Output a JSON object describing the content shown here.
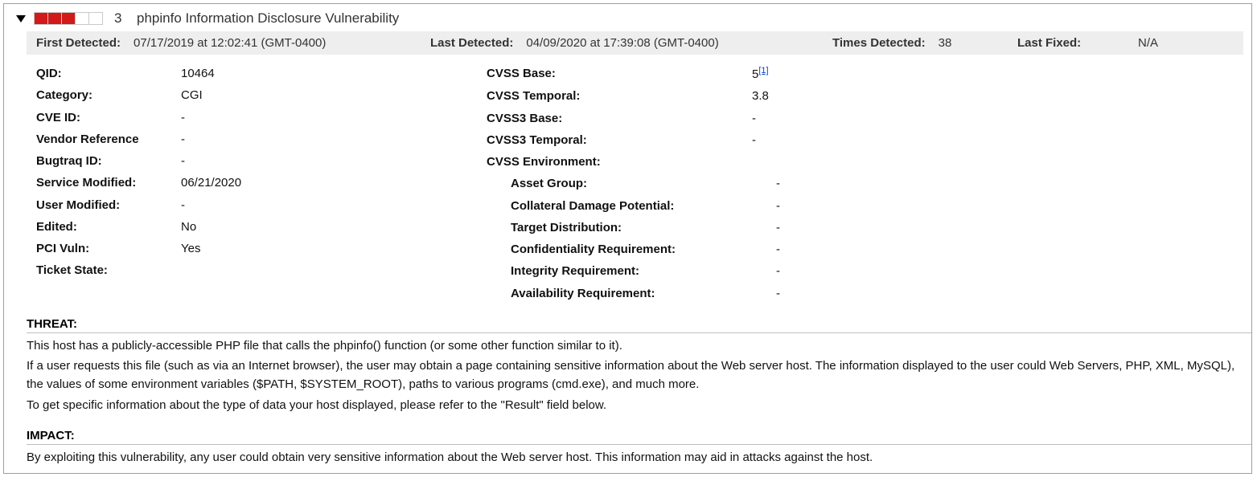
{
  "header": {
    "severity_level": 3,
    "title": "phpinfo Information Disclosure Vulnerability"
  },
  "detection": {
    "first_detected_label": "First Detected:",
    "first_detected_value": "07/17/2019 at 12:02:41 (GMT-0400)",
    "last_detected_label": "Last Detected:",
    "last_detected_value": "04/09/2020 at 17:39:08 (GMT-0400)",
    "times_detected_label": "Times Detected:",
    "times_detected_value": "38",
    "last_fixed_label": "Last Fixed:",
    "last_fixed_value": "N/A"
  },
  "details": {
    "left": {
      "qid": {
        "k": "QID:",
        "v": "10464"
      },
      "category": {
        "k": "Category:",
        "v": "CGI"
      },
      "cve_id": {
        "k": "CVE ID:",
        "v": "-"
      },
      "vendor_ref": {
        "k": "Vendor Reference",
        "v": "-"
      },
      "bugtraq_id": {
        "k": "Bugtraq ID:",
        "v": "-"
      },
      "service_modified": {
        "k": "Service Modified:",
        "v": "06/21/2020"
      },
      "user_modified": {
        "k": "User Modified:",
        "v": "-"
      },
      "edited": {
        "k": "Edited:",
        "v": "No"
      },
      "pci_vuln": {
        "k": "PCI Vuln:",
        "v": "Yes"
      },
      "ticket_state": {
        "k": "Ticket State:",
        "v": ""
      }
    },
    "right": {
      "cvss_base": {
        "k": "CVSS Base:",
        "v": "5",
        "note": "[1]"
      },
      "cvss_temporal": {
        "k": "CVSS Temporal:",
        "v": "3.8"
      },
      "cvss3_base": {
        "k": "CVSS3 Base:",
        "v": "-"
      },
      "cvss3_temporal": {
        "k": "CVSS3 Temporal:",
        "v": "-"
      },
      "cvss_env": {
        "k": "CVSS Environment:",
        "v": ""
      },
      "asset_group": {
        "k": "Asset Group:",
        "v": "-"
      },
      "cdp": {
        "k": "Collateral Damage Potential:",
        "v": "-"
      },
      "target_dist": {
        "k": "Target Distribution:",
        "v": "-"
      },
      "conf_req": {
        "k": "Confidentiality Requirement:",
        "v": "-"
      },
      "int_req": {
        "k": "Integrity Requirement:",
        "v": "-"
      },
      "avail_req": {
        "k": "Availability Requirement:",
        "v": "-"
      }
    }
  },
  "sections": {
    "threat": {
      "title": "THREAT:",
      "p1": "This host has a publicly-accessible PHP file that calls the phpinfo() function (or some other function similar to it).",
      "p2": "If a user requests this file (such as via an Internet browser), the user may obtain a page containing sensitive information about the Web server host. The information displayed to the user could Web Servers, PHP, XML, MySQL), the values of some environment variables ($PATH, $SYSTEM_ROOT), paths to various programs (cmd.exe), and much more.",
      "p3": "To get specific information about the type of data your host displayed, please refer to the \"Result\" field below."
    },
    "impact": {
      "title": "IMPACT:",
      "p1": "By exploiting this vulnerability, any user could obtain very sensitive information about the Web server host. This information may aid in attacks against the host."
    }
  }
}
